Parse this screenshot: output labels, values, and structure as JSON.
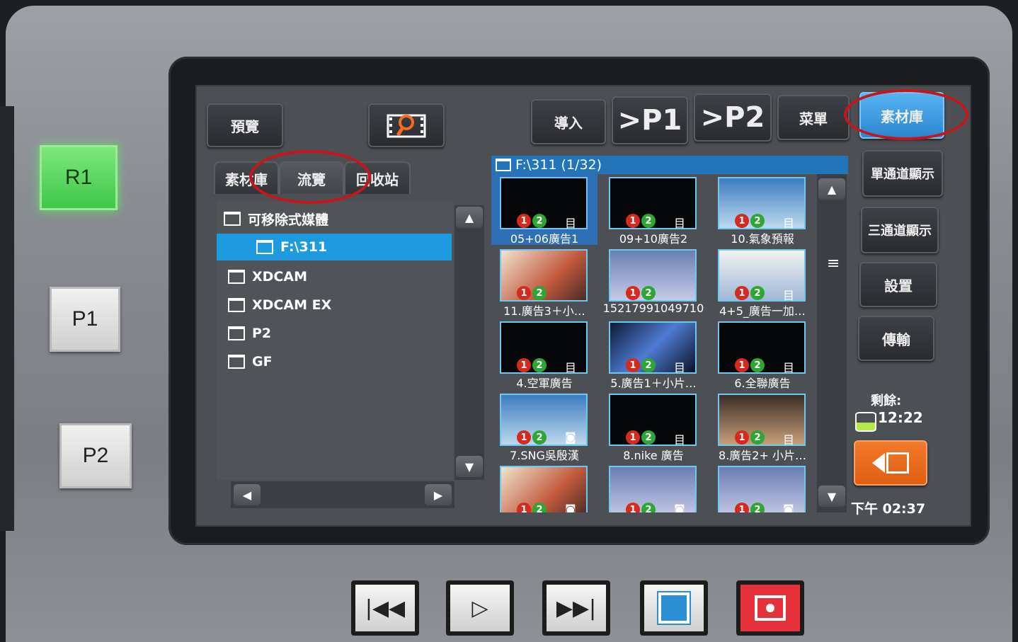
{
  "hardware": {
    "r1": "R1",
    "p1": "P1",
    "p2": "P2",
    "transport": [
      "rewind-icon",
      "play-icon",
      "fast-forward-icon",
      "stop-icon",
      "record-icon"
    ],
    "colors": {
      "r1": "#4fd14e",
      "stop": "#2a8fd3",
      "record": "#e5323a"
    }
  },
  "toolbar": {
    "preview": "預覽",
    "import": "導入",
    "p1": ">P1",
    "p2": ">P2",
    "menu": "菜單",
    "library": "素材庫"
  },
  "tabs": {
    "library": "素材庫",
    "browse": "流覽",
    "recycle": "回收站"
  },
  "tree": {
    "items": [
      {
        "label": "可移除式媒體"
      },
      {
        "label": "F:\\311"
      },
      {
        "label": "XDCAM"
      },
      {
        "label": "XDCAM EX"
      },
      {
        "label": "P2"
      },
      {
        "label": "GF"
      }
    ]
  },
  "grid": {
    "path": "F:\\311 (1/32)",
    "items": [
      {
        "caption": "05+06廣告1"
      },
      {
        "caption": "09+10廣告2"
      },
      {
        "caption": "10.氣象預報"
      },
      {
        "caption": "11.廣告3＋小…"
      },
      {
        "caption": "15217991049710"
      },
      {
        "caption": "4+5_廣告一加…"
      },
      {
        "caption": "4.空軍廣告"
      },
      {
        "caption": "5.廣告1＋小片…"
      },
      {
        "caption": "6.全聯廣告"
      },
      {
        "caption": "7.SNG吳殷漢"
      },
      {
        "caption": "8.nike 廣告"
      },
      {
        "caption": "8.廣告2+ 小片…"
      },
      {
        "caption": ""
      },
      {
        "caption": ""
      },
      {
        "caption": ""
      }
    ]
  },
  "side": {
    "single": "單通道顯示",
    "triple": "三通道顯示",
    "settings": "設置",
    "transfer": "傳輸"
  },
  "status": {
    "remain_label": "剩餘:",
    "remain_time": "12:22",
    "clock": "下午 02:37"
  }
}
